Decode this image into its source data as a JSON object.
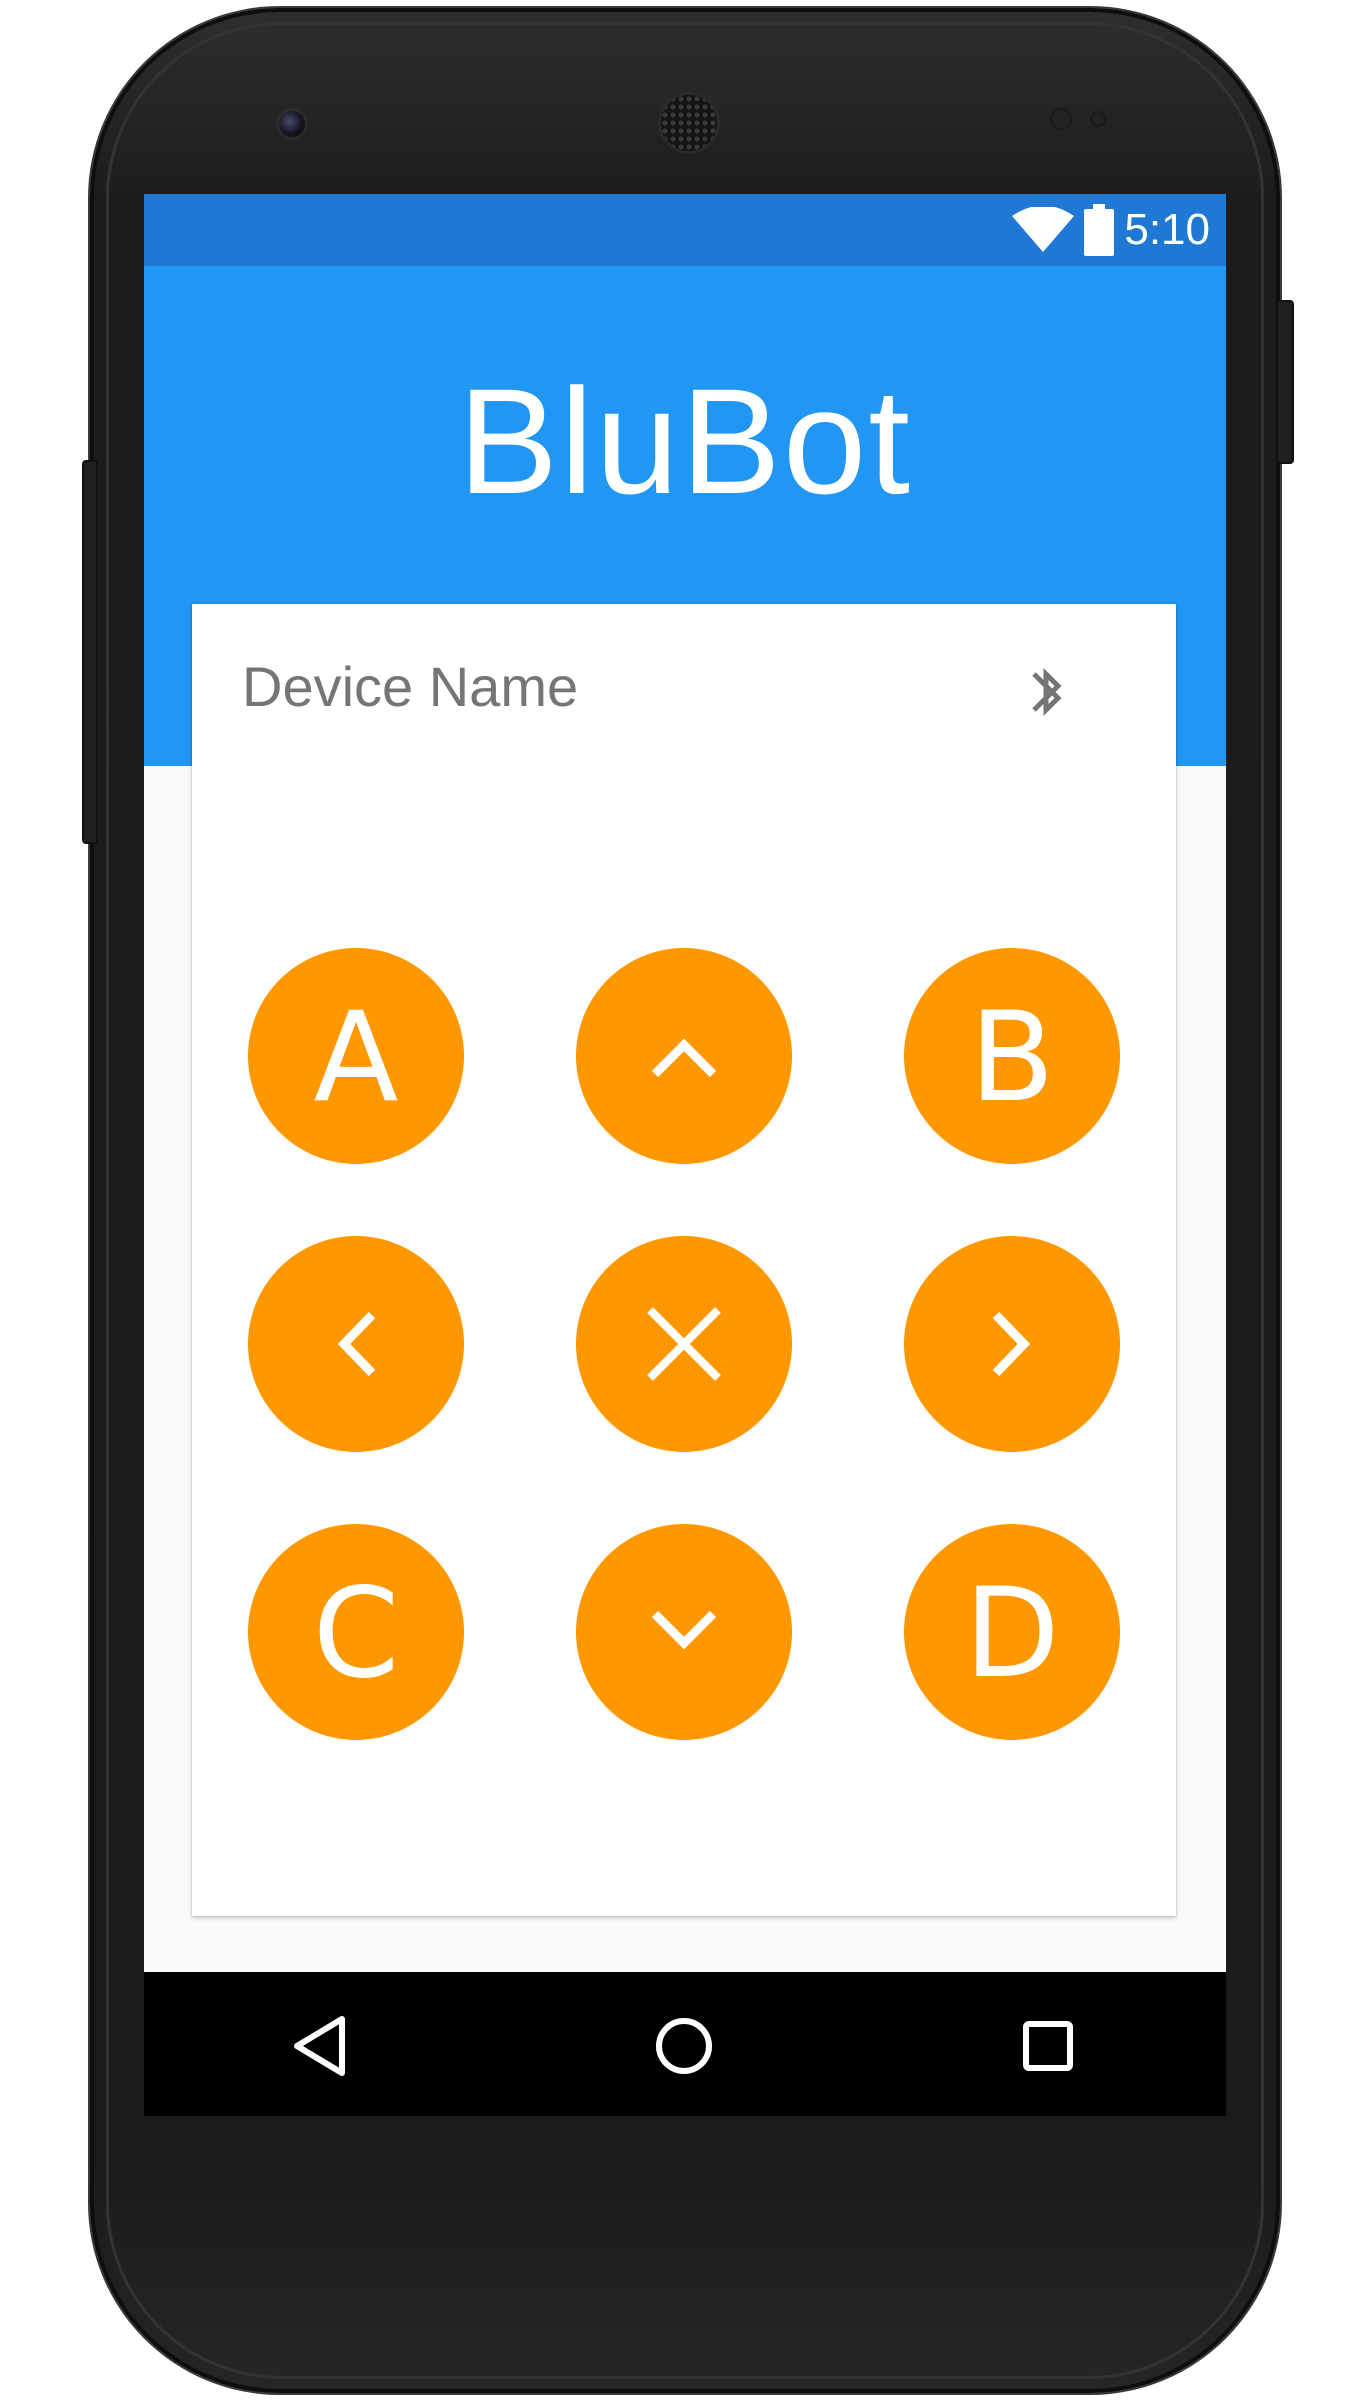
{
  "status_bar": {
    "time": "5:10",
    "icons": [
      "wifi-icon",
      "battery-icon"
    ]
  },
  "app_bar": {
    "title": "BluBot"
  },
  "device": {
    "name_label": "Device Name",
    "icon": "bluetooth-icon"
  },
  "controls": {
    "a_label": "A",
    "b_label": "B",
    "c_label": "C",
    "d_label": "D",
    "up_icon": "chevron-up-icon",
    "down_icon": "chevron-down-icon",
    "left_icon": "chevron-left-icon",
    "right_icon": "chevron-right-icon",
    "stop_icon": "close-icon"
  },
  "nav_bar": {
    "buttons": [
      "back-icon",
      "home-icon",
      "recents-icon"
    ]
  },
  "colors": {
    "status_bar": "#1e78d4",
    "app_bar": "#2196f3",
    "button": "#ff9800",
    "text_secondary": "#757575"
  }
}
